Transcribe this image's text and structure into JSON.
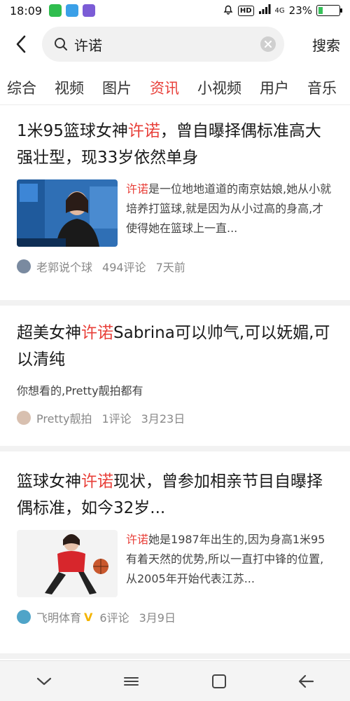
{
  "status_bar": {
    "time": "18:09",
    "network": "4G",
    "battery": "23%",
    "battery_level": 0.23
  },
  "search": {
    "query": "许诺",
    "submit_label": "搜索"
  },
  "tabs": [
    {
      "label": "综合"
    },
    {
      "label": "视频"
    },
    {
      "label": "图片"
    },
    {
      "label": "资讯",
      "active": true
    },
    {
      "label": "小视频"
    },
    {
      "label": "用户"
    },
    {
      "label": "音乐"
    }
  ],
  "results": [
    {
      "title_pre": "1米95篮球女神",
      "title_hl": "许诺",
      "title_post": "，曾自曝择偶标准高大强壮型，现33岁依然单身",
      "snippet_hl": "许诺",
      "snippet_post": "是一位地地道道的南京姑娘,她从小就培养打篮球,就是因为从小过高的身高,才使得她在篮球上一直...",
      "author": "老郭说个球",
      "comments": "494评论",
      "time": "7天前"
    },
    {
      "title_pre": "超美女神",
      "title_hl": "许诺",
      "title_post": "Sabrina可以帅气,可以妩媚,可以清纯",
      "desc": "你想看的,Pretty靓拍都有",
      "author": "Pretty靓拍",
      "comments": "1评论",
      "time": "3月23日"
    },
    {
      "title_pre": "篮球女神",
      "title_hl": "许诺",
      "title_post": "现状，曾参加相亲节目自曝择偶标准，如今32岁...",
      "snippet_hl": "许诺",
      "snippet_post": "她是1987年出生的,因为身高1米95有着天然的优势,所以一直打中锋的位置,从2005年开始代表江苏...",
      "author": "飞明体育",
      "verified": "V",
      "comments": "6评论",
      "time": "3月9日"
    }
  ],
  "colors": {
    "accent": "#e8403a",
    "meta": "#888888",
    "separator": "#f2f2f2"
  },
  "icons": [
    "back-arrow-icon",
    "search-icon",
    "clear-icon",
    "chevron-down-icon",
    "recent-apps-icon",
    "home-square-icon",
    "back-nav-icon"
  ]
}
